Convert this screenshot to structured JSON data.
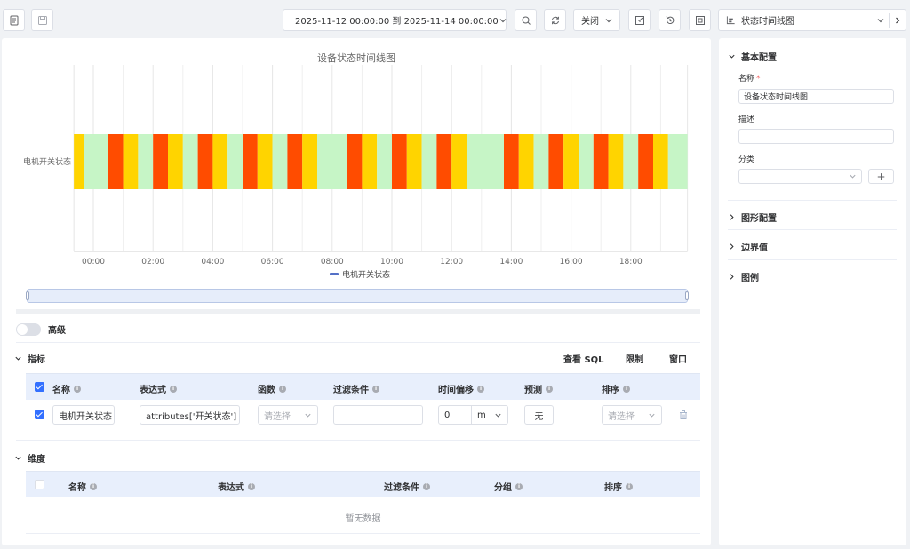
{
  "toolbar": {
    "time_range": "2025-11-12 00:00:00 到 2025-11-14 00:00:00",
    "refresh_select": "关闭",
    "chart_type": "状态时间线图"
  },
  "chart_data": {
    "type": "state-timeline",
    "title": "设备状态时间线图",
    "row_label": "电机开关状态",
    "x_ticks": [
      "00:00",
      "02:00",
      "04:00",
      "06:00",
      "08:00",
      "10:00",
      "12:00",
      "14:00",
      "16:00",
      "18:00"
    ],
    "x_range": [
      "-00:38",
      "19:55"
    ],
    "legend": "电机开关状态",
    "colors": {
      "state_green": "#c6f5c6",
      "state_red": "#ff4c00",
      "state_yellow": "#ffd400"
    },
    "segments": [
      {
        "start": -0.65,
        "end": -0.3,
        "state": "yellow"
      },
      {
        "start": -0.3,
        "end": 0.5,
        "state": "green"
      },
      {
        "start": 0.5,
        "end": 1.0,
        "state": "red"
      },
      {
        "start": 1.0,
        "end": 1.5,
        "state": "yellow"
      },
      {
        "start": 1.5,
        "end": 2.0,
        "state": "green"
      },
      {
        "start": 2.0,
        "end": 2.5,
        "state": "red"
      },
      {
        "start": 2.5,
        "end": 3.0,
        "state": "yellow"
      },
      {
        "start": 3.0,
        "end": 3.5,
        "state": "green"
      },
      {
        "start": 3.5,
        "end": 4.0,
        "state": "red"
      },
      {
        "start": 4.0,
        "end": 4.5,
        "state": "yellow"
      },
      {
        "start": 4.5,
        "end": 5.0,
        "state": "green"
      },
      {
        "start": 5.0,
        "end": 5.5,
        "state": "red"
      },
      {
        "start": 5.5,
        "end": 6.0,
        "state": "yellow"
      },
      {
        "start": 6.0,
        "end": 6.5,
        "state": "green"
      },
      {
        "start": 6.5,
        "end": 7.0,
        "state": "red"
      },
      {
        "start": 7.0,
        "end": 7.5,
        "state": "yellow"
      },
      {
        "start": 7.5,
        "end": 8.5,
        "state": "green"
      },
      {
        "start": 8.5,
        "end": 9.0,
        "state": "red"
      },
      {
        "start": 9.0,
        "end": 9.5,
        "state": "yellow"
      },
      {
        "start": 9.5,
        "end": 10.0,
        "state": "green"
      },
      {
        "start": 10.0,
        "end": 10.5,
        "state": "red"
      },
      {
        "start": 10.5,
        "end": 11.0,
        "state": "yellow"
      },
      {
        "start": 11.0,
        "end": 11.5,
        "state": "green"
      },
      {
        "start": 11.5,
        "end": 12.0,
        "state": "red"
      },
      {
        "start": 12.0,
        "end": 12.5,
        "state": "yellow"
      },
      {
        "start": 12.5,
        "end": 13.75,
        "state": "green"
      },
      {
        "start": 13.75,
        "end": 14.25,
        "state": "red"
      },
      {
        "start": 14.25,
        "end": 14.75,
        "state": "yellow"
      },
      {
        "start": 14.75,
        "end": 15.25,
        "state": "green"
      },
      {
        "start": 15.25,
        "end": 15.75,
        "state": "red"
      },
      {
        "start": 15.75,
        "end": 16.25,
        "state": "yellow"
      },
      {
        "start": 16.25,
        "end": 16.75,
        "state": "green"
      },
      {
        "start": 16.75,
        "end": 17.25,
        "state": "red"
      },
      {
        "start": 17.25,
        "end": 17.75,
        "state": "yellow"
      },
      {
        "start": 17.75,
        "end": 18.25,
        "state": "green"
      },
      {
        "start": 18.25,
        "end": 18.75,
        "state": "red"
      },
      {
        "start": 18.75,
        "end": 19.25,
        "state": "yellow"
      },
      {
        "start": 19.25,
        "end": 19.9,
        "state": "green"
      }
    ]
  },
  "advanced": {
    "label": "高级"
  },
  "metrics": {
    "title": "指标",
    "links": {
      "sql": "查看 SQL",
      "limit": "限制",
      "window": "窗口"
    },
    "columns": [
      "名称",
      "表达式",
      "函数",
      "过滤条件",
      "时间偏移",
      "预测",
      "排序"
    ],
    "row": {
      "name": "电机开关状态",
      "expression": "attributes['开关状态']",
      "function_placeholder": "请选择",
      "filter": "",
      "offset_value": "0",
      "offset_unit": "m",
      "forecast": "无",
      "sort_placeholder": "请选择"
    }
  },
  "dimensions": {
    "title": "维度",
    "columns": [
      "名称",
      "表达式",
      "过滤条件",
      "分组",
      "排序"
    ],
    "empty": "暂无数据"
  },
  "side": {
    "basic": {
      "title": "基本配置",
      "name_label": "名称",
      "name_required": "*",
      "name_value": "设备状态时间线图",
      "desc_label": "描述",
      "desc_value": "",
      "category_label": "分类",
      "category_value": "",
      "add_symbol": "+"
    },
    "sections": [
      "图形配置",
      "边界值",
      "图例"
    ]
  }
}
